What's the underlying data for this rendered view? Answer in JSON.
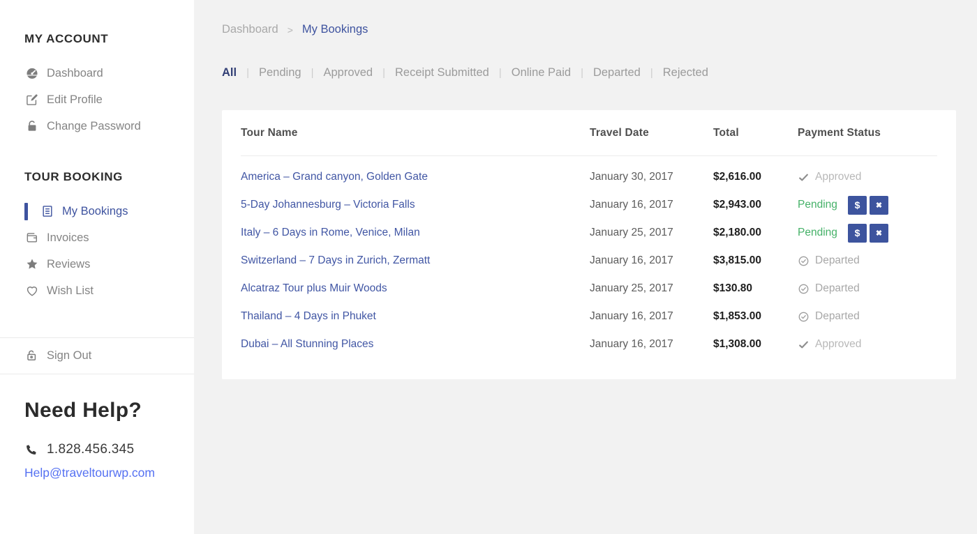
{
  "colors": {
    "accent_blue": "#3e539f",
    "button_blue": "#3d549e",
    "pending_green": "#45b168",
    "email_link_blue": "#5571f2",
    "main_background": "#f2f2f2",
    "sidebar_background": "#ffffff"
  },
  "sidebar": {
    "sections": [
      {
        "title": "MY ACCOUNT",
        "items": [
          {
            "label": "Dashboard",
            "icon": "dashboard-icon",
            "active": false
          },
          {
            "label": "Edit Profile",
            "icon": "edit-icon",
            "active": false
          },
          {
            "label": "Change Password",
            "icon": "lock-icon",
            "active": false
          }
        ]
      },
      {
        "title": "TOUR BOOKING",
        "items": [
          {
            "label": "My Bookings",
            "icon": "bookings-icon",
            "active": true
          },
          {
            "label": "Invoices",
            "icon": "wallet-icon",
            "active": false
          },
          {
            "label": "Reviews",
            "icon": "star-icon",
            "active": false
          },
          {
            "label": "Wish List",
            "icon": "heart-icon",
            "active": false
          }
        ]
      }
    ],
    "sign_out_label": "Sign Out",
    "help": {
      "title": "Need Help?",
      "phone": "1.828.456.345",
      "email": "Help@traveltourwp.com"
    }
  },
  "breadcrumb": {
    "parent": "Dashboard",
    "separator": ">",
    "current": "My Bookings"
  },
  "filter_tabs": {
    "active": "All",
    "separator": "|",
    "items": [
      "All",
      "Pending",
      "Approved",
      "Receipt Submitted",
      "Online Paid",
      "Departed",
      "Rejected"
    ]
  },
  "bookings_table": {
    "headers": [
      "Tour Name",
      "Travel Date",
      "Total",
      "Payment Status"
    ],
    "rows": [
      {
        "tour_name": "America – Grand canyon, Golden Gate",
        "travel_date": "January 30, 2017",
        "total": "$2,616.00",
        "status": "Approved",
        "status_type": "approved"
      },
      {
        "tour_name": "5-Day Johannesburg – Victoria Falls",
        "travel_date": "January 16, 2017",
        "total": "$2,943.00",
        "status": "Pending",
        "status_type": "pending",
        "actions": [
          {
            "name": "pay",
            "glyph": "$"
          },
          {
            "name": "cancel",
            "glyph": "✖"
          }
        ]
      },
      {
        "tour_name": "Italy – 6 Days in Rome, Venice, Milan",
        "travel_date": "January 25, 2017",
        "total": "$2,180.00",
        "status": "Pending",
        "status_type": "pending",
        "actions": [
          {
            "name": "pay",
            "glyph": "$"
          },
          {
            "name": "cancel",
            "glyph": "✖"
          }
        ]
      },
      {
        "tour_name": "Switzerland – 7 Days in Zurich, Zermatt",
        "travel_date": "January 16, 2017",
        "total": "$3,815.00",
        "status": "Departed",
        "status_type": "departed"
      },
      {
        "tour_name": "Alcatraz Tour plus Muir Woods",
        "travel_date": "January 25, 2017",
        "total": "$130.80",
        "status": "Departed",
        "status_type": "departed"
      },
      {
        "tour_name": "Thailand – 4 Days in Phuket",
        "travel_date": "January 16, 2017",
        "total": "$1,853.00",
        "status": "Departed",
        "status_type": "departed"
      },
      {
        "tour_name": "Dubai – All Stunning Places",
        "travel_date": "January 16, 2017",
        "total": "$1,308.00",
        "status": "Approved",
        "status_type": "approved"
      }
    ]
  }
}
